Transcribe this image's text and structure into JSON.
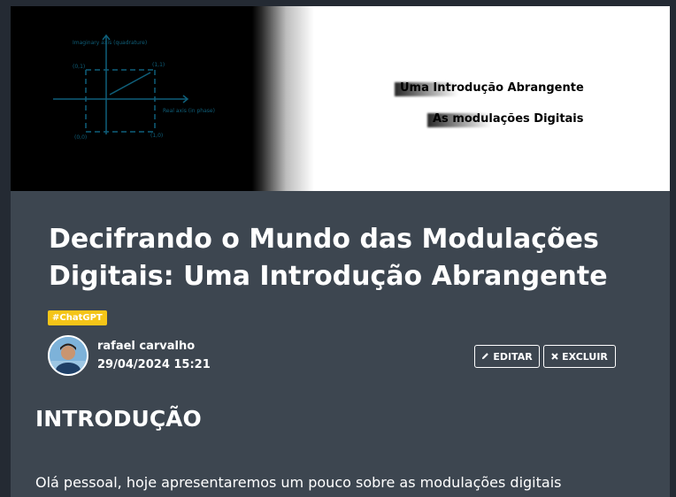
{
  "banner": {
    "diagram": {
      "y_axis_label": "Imaginary axis (quadrature)",
      "x_axis_label": "Real axis (in phase)",
      "point_labels": [
        "(0,1)",
        "(1,1)",
        "(0,0)",
        "(1,0)"
      ]
    },
    "line1": "Uma Introdução Abrangente",
    "line2": "As modulações Digitais"
  },
  "post": {
    "title": "Decifrando o Mundo das Modulações Digitais: Uma Introdução Abrangente",
    "tag": "#ChatGPT",
    "author": "rafael carvalho",
    "date": "29/04/2024 15:21",
    "edit_label": "EDITAR",
    "delete_label": "EXCLUIR",
    "section_title": "INTRODUÇÃO",
    "paragraph": "Olá pessoal, hoje apresentaremos um pouco sobre as modulações digitais"
  },
  "icons": {
    "edit": "pencil-icon",
    "delete": "close-icon"
  },
  "colors": {
    "tag": "#f5c518",
    "card": "#3d4650",
    "diagram": "#0f5f7a"
  }
}
